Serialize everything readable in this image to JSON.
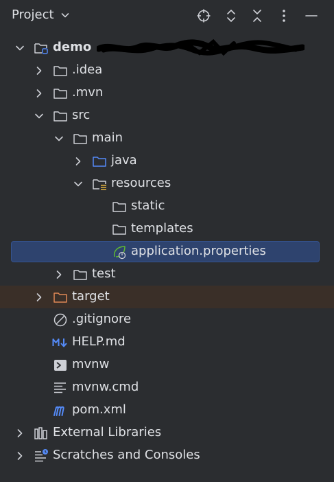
{
  "header": {
    "title": "Project",
    "icons": [
      "locate-icon",
      "expand-collapse-icon",
      "collapse-all-icon",
      "more-options-icon",
      "minimize-icon"
    ]
  },
  "tree": {
    "root": "demo",
    "idea": ".idea",
    "mvn": ".mvn",
    "src": "src",
    "main": "main",
    "java": "java",
    "resources": "resources",
    "static": "static",
    "templates": "templates",
    "application_properties": "application.properties",
    "test": "test",
    "target": "target",
    "gitignore": ".gitignore",
    "help_md": "HELP.md",
    "mvnw": "mvnw",
    "mvnw_cmd": "mvnw.cmd",
    "pom_xml": "pom.xml",
    "external_libraries": "External Libraries",
    "scratches": "Scratches and Consoles"
  },
  "colors": {
    "background": "#2b2d30",
    "text": "#dfe1e5",
    "icon": "#ced0d6",
    "selection": "#2e436e",
    "selection_border": "#35538f",
    "excluded_bg": "#3a2f28",
    "excluded_folder": "#e08855",
    "source_folder": "#548af7",
    "spring_green": "#5fb832",
    "markdown_blue": "#548af7",
    "maven_blue": "#548af7"
  }
}
